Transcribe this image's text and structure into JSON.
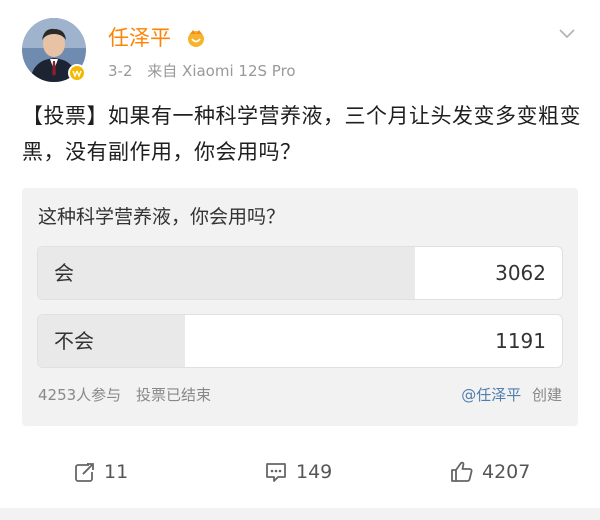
{
  "post": {
    "author": {
      "name": "任泽平",
      "avatar_icon": "person-avatar",
      "verified_color": "#f5b800",
      "name_color": "#ff8200"
    },
    "date": "3-2",
    "source": "来自 Xiaomi 12S Pro",
    "text": "【投票】如果有一种科学营养液，三个月让头发变多变粗变黑，没有副作用，你会用吗？"
  },
  "poll": {
    "question": "这种科学营养液，你会用吗？",
    "options": [
      {
        "label": "会",
        "count": "3062",
        "share": 0.72
      },
      {
        "label": "不会",
        "count": "1191",
        "share": 0.28
      }
    ],
    "participants": "4253人参与",
    "status": "投票已结束",
    "creator_mention": "@任泽平",
    "created_label": "创建"
  },
  "actions": {
    "repost_count": "11",
    "comment_count": "149",
    "like_count": "4207"
  }
}
